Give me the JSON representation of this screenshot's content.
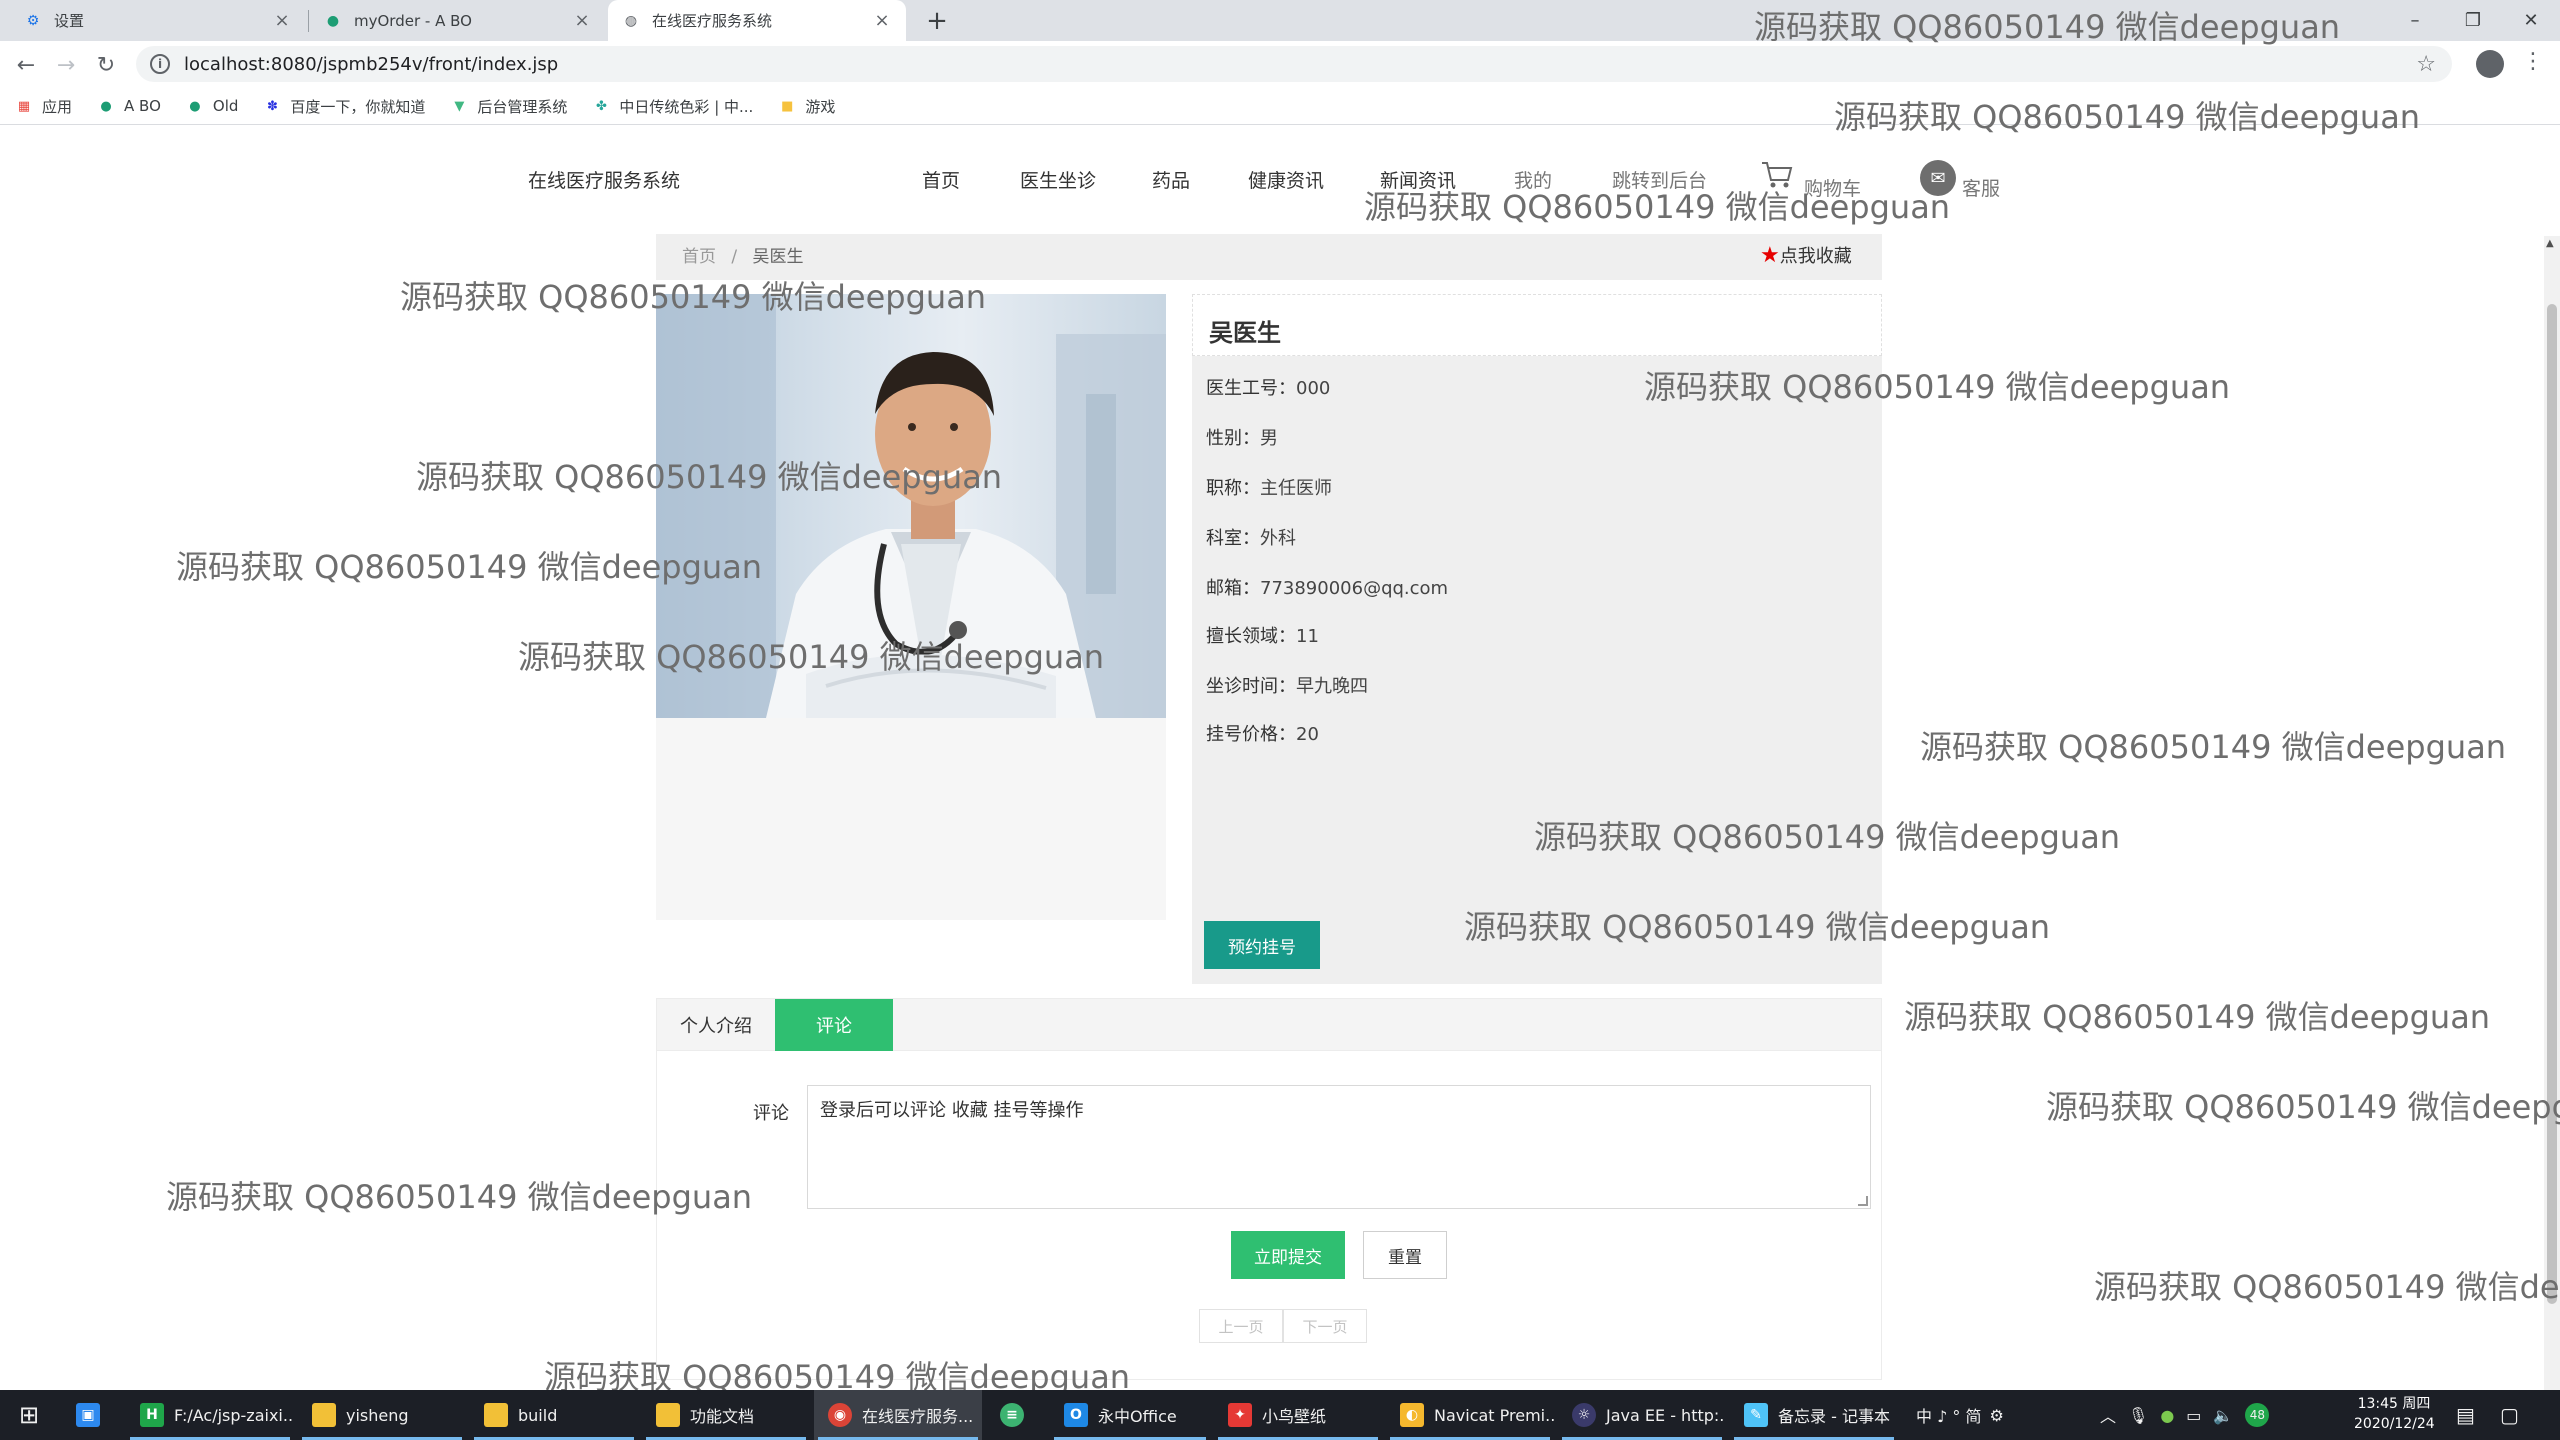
{
  "browser": {
    "tabs": [
      {
        "title": "设置",
        "active": false
      },
      {
        "title": "myOrder - A BO",
        "active": false
      },
      {
        "title": "在线医疗服务系统",
        "active": true
      }
    ],
    "url": "localhost:8080/jspmb254v/front/index.jsp",
    "bookmarks": [
      "应用",
      "A BO",
      "Old",
      "百度一下，你就知道",
      "后台管理系统",
      "中日传统色彩 | 中...",
      "游戏"
    ]
  },
  "site": {
    "title": "在线医疗服务系统",
    "menu": [
      "首页",
      "医生坐诊",
      "药品",
      "健康资讯",
      "新闻资讯",
      "我的",
      "跳转到后台",
      "购物车",
      "客服"
    ]
  },
  "breadcrumb": {
    "home": "首页",
    "sep": "/",
    "current": "吴医生"
  },
  "favorite_label": "点我收藏",
  "doctor": {
    "name": "吴医生",
    "fields": [
      {
        "key": "医生工号：",
        "value": "000"
      },
      {
        "key": "性别：",
        "value": "男"
      },
      {
        "key": "职称：",
        "value": "主任医师"
      },
      {
        "key": "科室：",
        "value": "外科"
      },
      {
        "key": "邮箱：",
        "value": "773890006@qq.com"
      },
      {
        "key": "擅长领域：",
        "value": "11"
      },
      {
        "key": "坐诊时间：",
        "value": "早九晚四"
      },
      {
        "key": "挂号价格：",
        "value": "20"
      }
    ],
    "book_button": "预约挂号"
  },
  "detail_tabs": {
    "intro": "个人介绍",
    "comments": "评论"
  },
  "comment_form": {
    "label": "评论",
    "value": "登录后可以评论 收藏 挂号等操作",
    "submit": "立即提交",
    "reset": "重置",
    "prev": "上一页",
    "next": "下一页"
  },
  "watermark": "源码获取 QQ86050149 微信deepguan",
  "taskbar": {
    "items": [
      "F:/Ac/jsp-zaixi...",
      "yisheng",
      "build",
      "功能文档",
      "在线医疗服务...",
      "",
      "永中Office",
      "小鸟壁纸",
      "Navicat Premi...",
      "Java EE - http:...",
      "备忘录 - 记事本"
    ],
    "tray_text": "中 ♪ ° 简",
    "battery_badge": "48",
    "time": "13:45 周四",
    "date": "2020/12/24"
  },
  "colors": {
    "accent_teal": "#189a8a",
    "accent_green": "#2fbf71",
    "fav_star": "#e60000"
  }
}
